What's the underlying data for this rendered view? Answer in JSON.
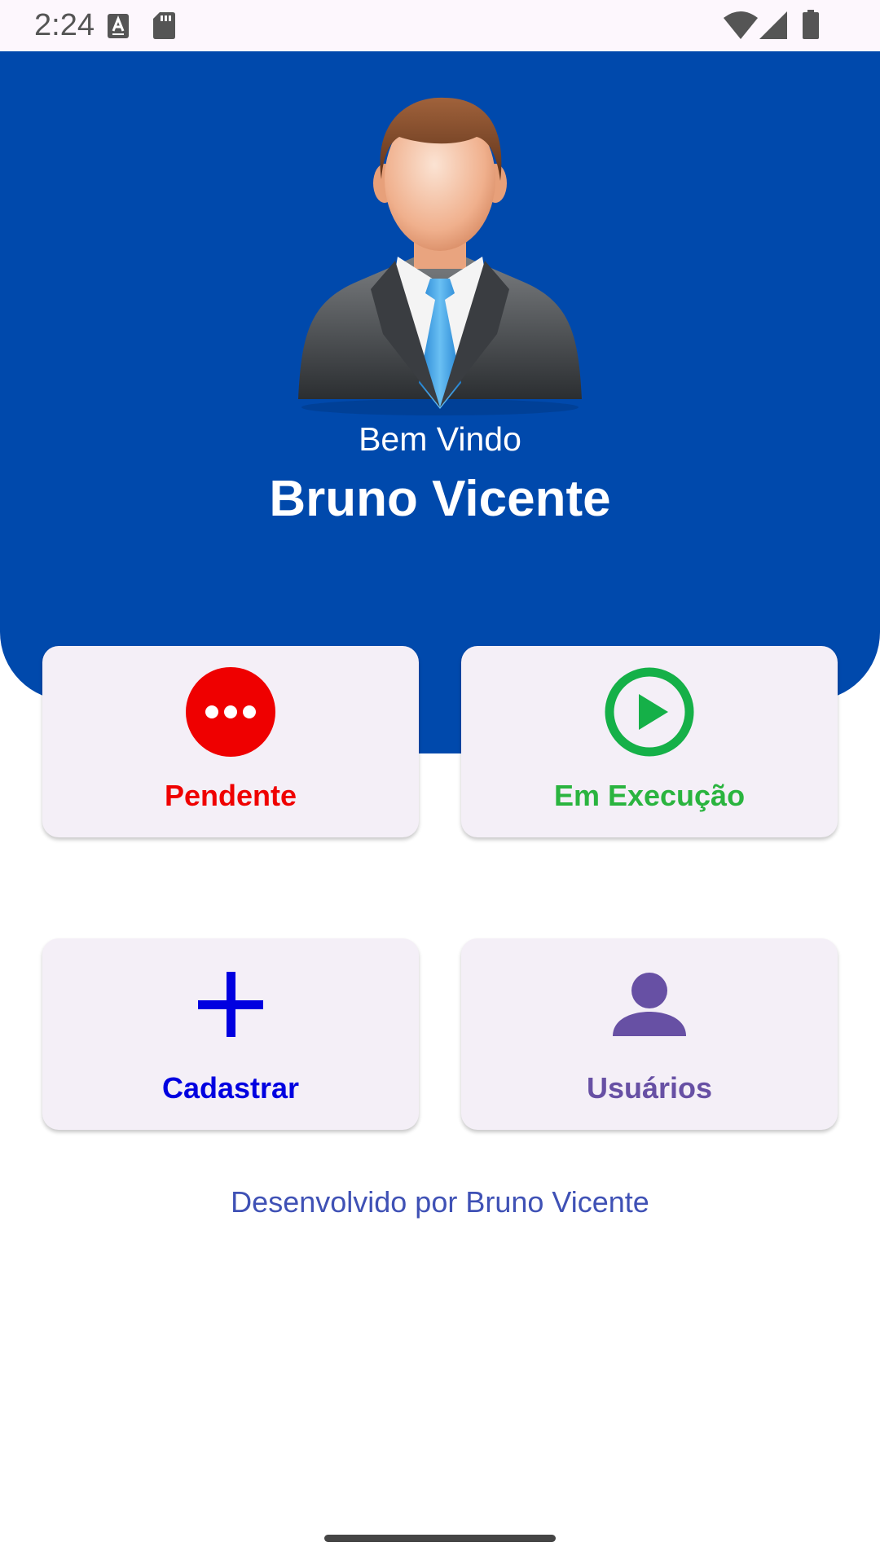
{
  "status_bar": {
    "time": "2:24",
    "icons": [
      "keyboard-icon",
      "sd-card-icon",
      "wifi-icon",
      "cell-signal-icon",
      "battery-icon"
    ]
  },
  "header": {
    "background": "#0049ac",
    "greeting": "Bem Vindo",
    "user_name": "Bruno Vicente",
    "avatar_icon": "businessman-avatar-icon"
  },
  "cards": [
    {
      "label": "Pendente",
      "color": "#ef0000",
      "icon": "more-dots-icon"
    },
    {
      "label": "Em Execução",
      "color": "#2ab43f",
      "icon": "play-circle-icon"
    },
    {
      "label": "Cadastrar",
      "color": "#0000e0",
      "icon": "plus-icon"
    },
    {
      "label": "Usuários",
      "color": "#6750a4",
      "icon": "person-icon"
    }
  ],
  "footer": {
    "text": "Desenvolvido por Bruno Vicente",
    "color": "#3f51b5"
  }
}
